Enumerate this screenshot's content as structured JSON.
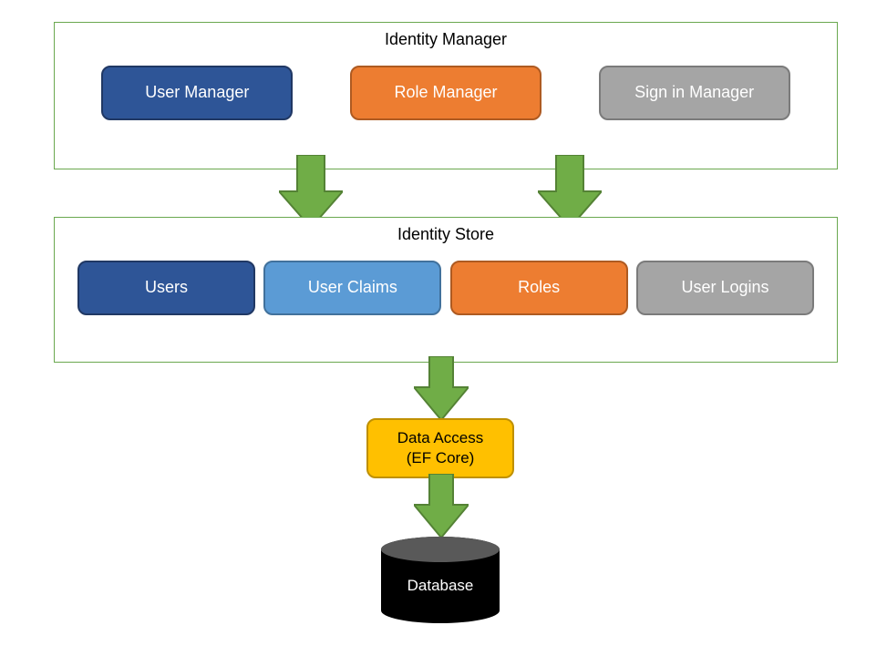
{
  "manager": {
    "title": "Identity Manager",
    "items": [
      {
        "label": "User Manager",
        "color": "blue-dark"
      },
      {
        "label": "Role Manager",
        "color": "orange"
      },
      {
        "label": "Sign in Manager",
        "color": "gray"
      }
    ]
  },
  "store": {
    "title": "Identity Store",
    "items": [
      {
        "label": "Users",
        "color": "blue-dark"
      },
      {
        "label": "User Claims",
        "color": "blue-light"
      },
      {
        "label": "Roles",
        "color": "orange"
      },
      {
        "label": "User Logins",
        "color": "gray"
      }
    ]
  },
  "data_access": {
    "line1": "Data Access",
    "line2": "(EF Core)"
  },
  "database": {
    "label": "Database"
  },
  "colors": {
    "arrow_fill": "#70ad47",
    "arrow_stroke": "#548235"
  }
}
